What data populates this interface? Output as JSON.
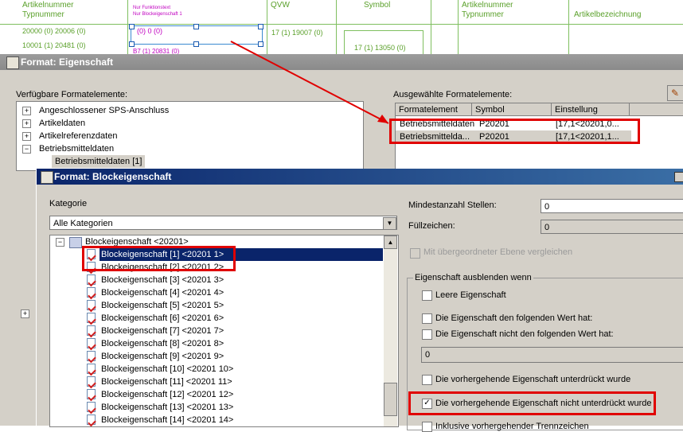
{
  "schematic": {
    "col_artikel_left": "Artikelnummer",
    "col_typ_left": "Typnummer",
    "row1": "20000 (0) 20006 (0)",
    "row2": "10001 (1) 20481 (0)",
    "magenta1": "(0) 0 (0)",
    "magenta2": "B7 (1) 20831 (0)",
    "tiny1": "Nur Funktionstext",
    "tiny2": "Nur Blockeigenschaft 1",
    "col_qvw": "QVW",
    "col_symbol": "Symbol",
    "val_qvw": "17 (1) 19007 (0)",
    "val_symbol": "17 (1) 13050 (0)",
    "col_artikel_right": "Artikelnummer",
    "col_typ_right": "Typnummer",
    "col_bez_right": "Artikelbezeichnung"
  },
  "format_window": {
    "title": "Format: Eigenschaft",
    "available_label": "Verfügbare Formatelemente:",
    "selected_label": "Ausgewählte Formatelemente:",
    "tree_items": [
      {
        "label": "Angeschlossener SPS-Anschluss",
        "expander": "+"
      },
      {
        "label": "Artikeldaten",
        "expander": "+"
      },
      {
        "label": "Artikelreferenzdaten",
        "expander": "+"
      },
      {
        "label": "Betriebsmitteldaten",
        "expander": "−"
      },
      {
        "label": "Betriebsmitteldaten [1]",
        "expander": ""
      }
    ],
    "selected_columns": [
      "Formatelement",
      "Symbol",
      "Einstellung"
    ],
    "selected_rows": [
      [
        "Betriebsmitteldaten",
        "P20201",
        "[17,1<20201,0..."
      ],
      [
        "Betriebsmittelda...",
        "P20201",
        "[17,1<20201,1..."
      ]
    ],
    "side_expander": "+"
  },
  "block_window": {
    "title": "Format: Blockeigenschaft",
    "kategorie_label": "Kategorie",
    "kategorie_value": "Alle Kategorien",
    "root_label": "Blockeigenschaft <20201>",
    "items": [
      "Blockeigenschaft [1] <20201 1>",
      "Blockeigenschaft [2] <20201 2>",
      "Blockeigenschaft [3] <20201 3>",
      "Blockeigenschaft [4] <20201 4>",
      "Blockeigenschaft [5] <20201 5>",
      "Blockeigenschaft [6] <20201 6>",
      "Blockeigenschaft [7] <20201 7>",
      "Blockeigenschaft [8] <20201 8>",
      "Blockeigenschaft [9] <20201 9>",
      "Blockeigenschaft [10] <20201 10>",
      "Blockeigenschaft [11] <20201 11>",
      "Blockeigenschaft [12] <20201 12>",
      "Blockeigenschaft [13] <20201 13>",
      "Blockeigenschaft [14] <20201 14>"
    ],
    "mindest_label": "Mindestanzahl Stellen:",
    "mindest_value": "0",
    "fuell_label": "Füllzeichen:",
    "fuell_value": "0",
    "vergleich_label": "Mit übergeordneter Ebene vergleichen",
    "group_label": "Eigenschaft ausblenden wenn",
    "cb_leere": "Leere Eigenschaft",
    "cb_hat": "Die Eigenschaft den folgenden Wert hat:",
    "cb_nicht_hat": "Die Eigenschaft nicht den folgenden Wert hat:",
    "wert_value": "0",
    "cb_unterdrueckt": "Die vorhergehende Eigenschaft unterdrückt wurde",
    "cb_nicht_unterdrueckt": "Die vorhergehende Eigenschaft nicht unterdrückt wurde",
    "cb_inklusive": "Inklusive vorhergehender Trennzeichen",
    "check_mark": "✓"
  },
  "colors": {
    "annotation_red": "#e00000",
    "selection_blue": "#0a246a"
  }
}
